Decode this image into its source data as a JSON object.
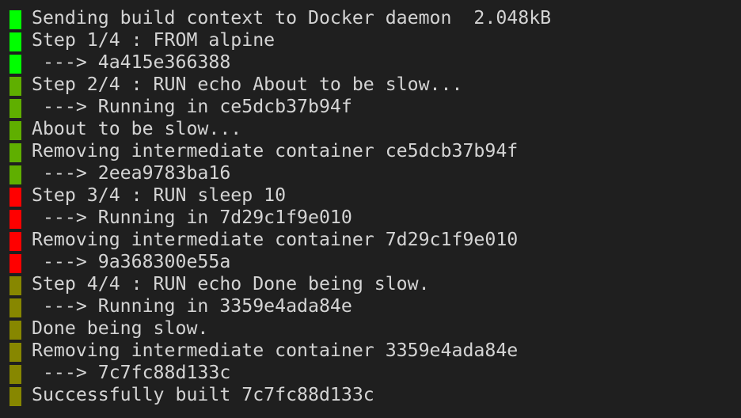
{
  "colors": {
    "context": "#00ff00",
    "step1": "#00ff00",
    "step2": "#5faf00",
    "step3": "#ff0000",
    "step4": "#878700",
    "background": "#1f1f1f",
    "text": "#d4d4d4"
  },
  "lines": [
    {
      "text": "Sending build context to Docker daemon  2.048kB",
      "color": "#00ff00"
    },
    {
      "text": "Step 1/4 : FROM alpine",
      "color": "#00ff00"
    },
    {
      "text": " ---> 4a415e366388",
      "color": "#00ff00"
    },
    {
      "text": "Step 2/4 : RUN echo About to be slow...",
      "color": "#5faf00"
    },
    {
      "text": " ---> Running in ce5dcb37b94f",
      "color": "#5faf00"
    },
    {
      "text": "About to be slow...",
      "color": "#5faf00"
    },
    {
      "text": "Removing intermediate container ce5dcb37b94f",
      "color": "#5faf00"
    },
    {
      "text": " ---> 2eea9783ba16",
      "color": "#5faf00"
    },
    {
      "text": "Step 3/4 : RUN sleep 10",
      "color": "#ff0000"
    },
    {
      "text": " ---> Running in 7d29c1f9e010",
      "color": "#ff0000"
    },
    {
      "text": "Removing intermediate container 7d29c1f9e010",
      "color": "#ff0000"
    },
    {
      "text": " ---> 9a368300e55a",
      "color": "#ff0000"
    },
    {
      "text": "Step 4/4 : RUN echo Done being slow.",
      "color": "#878700"
    },
    {
      "text": " ---> Running in 3359e4ada84e",
      "color": "#878700"
    },
    {
      "text": "Done being slow.",
      "color": "#878700"
    },
    {
      "text": "Removing intermediate container 3359e4ada84e",
      "color": "#878700"
    },
    {
      "text": " ---> 7c7fc88d133c",
      "color": "#878700"
    },
    {
      "text": "Successfully built 7c7fc88d133c",
      "color": "#878700"
    }
  ]
}
